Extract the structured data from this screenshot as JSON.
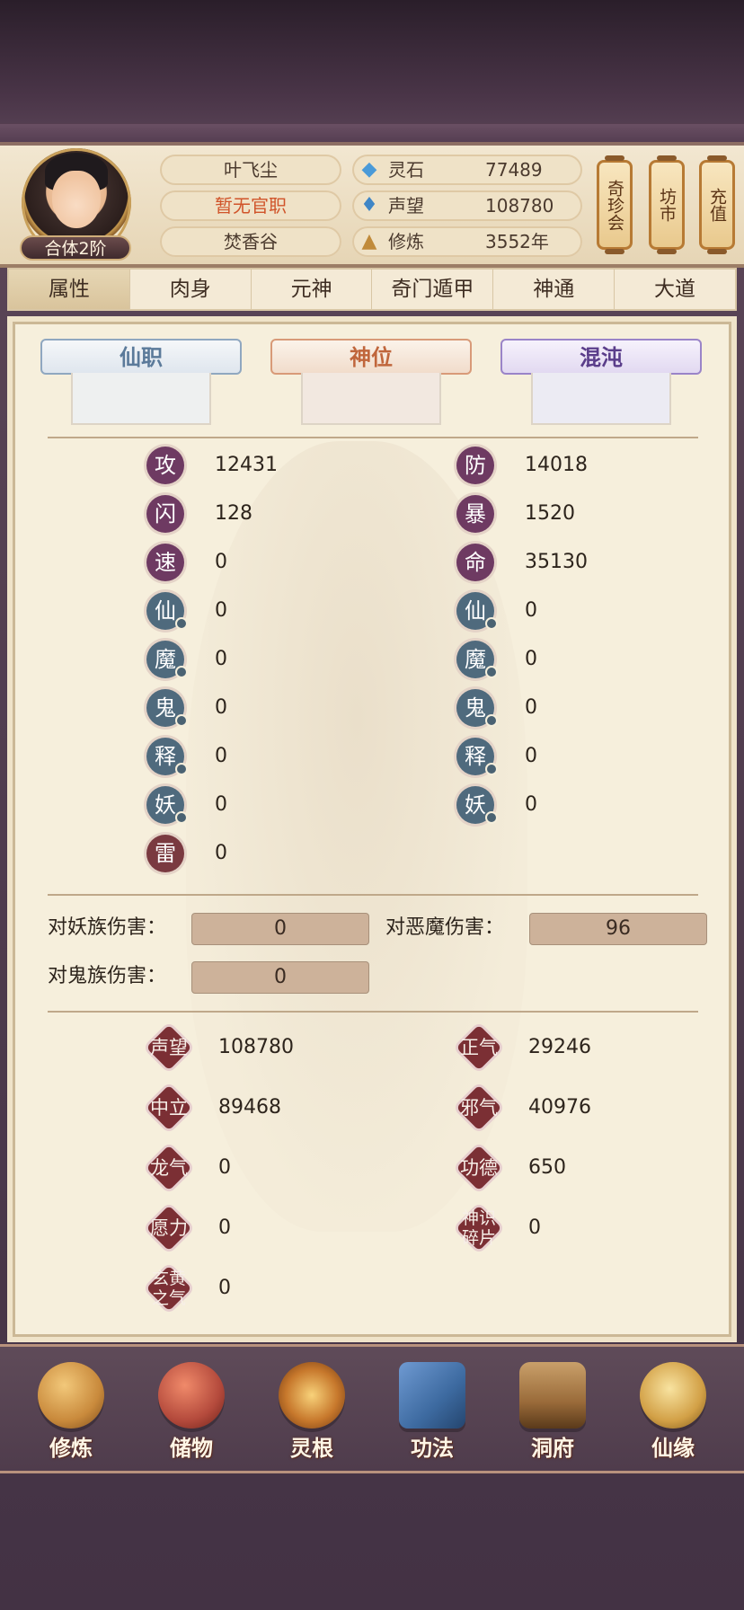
{
  "player": {
    "name": "叶飞尘",
    "title": "暂无官职",
    "sect": "焚香谷",
    "rank": "合体2阶"
  },
  "resources": [
    {
      "icon": "spirit-stone-icon",
      "label": "灵石",
      "value": "77489"
    },
    {
      "icon": "reputation-icon",
      "label": "声望",
      "value": "108780"
    },
    {
      "icon": "cultivation-icon",
      "label": "修炼",
      "value": "3552年"
    }
  ],
  "side_buttons": [
    "奇珍会",
    "坊市",
    "充值"
  ],
  "tabs": [
    "属性",
    "肉身",
    "元神",
    "奇门遁甲",
    "神通",
    "大道"
  ],
  "active_tab": "属性",
  "categories": [
    {
      "label": "仙职",
      "color": "#5b7a9a"
    },
    {
      "label": "神位",
      "color": "#c0663c"
    },
    {
      "label": "混沌",
      "color": "#5a3d8a"
    }
  ],
  "stats_left": [
    {
      "label": "攻",
      "value": "12431",
      "style": "purple"
    },
    {
      "label": "闪",
      "value": "128",
      "style": "purple"
    },
    {
      "label": "速",
      "value": "0",
      "style": "purple"
    },
    {
      "label": "仙",
      "value": "0",
      "style": "blue"
    },
    {
      "label": "魔",
      "value": "0",
      "style": "blue"
    },
    {
      "label": "鬼",
      "value": "0",
      "style": "blue"
    },
    {
      "label": "释",
      "value": "0",
      "style": "blue"
    },
    {
      "label": "妖",
      "value": "0",
      "style": "blue"
    },
    {
      "label": "雷",
      "value": "0",
      "style": "red"
    }
  ],
  "stats_right": [
    {
      "label": "防",
      "value": "14018",
      "style": "purple"
    },
    {
      "label": "暴",
      "value": "1520",
      "style": "purple"
    },
    {
      "label": "命",
      "value": "35130",
      "style": "purple"
    },
    {
      "label": "仙",
      "value": "0",
      "style": "blue"
    },
    {
      "label": "魔",
      "value": "0",
      "style": "blue"
    },
    {
      "label": "鬼",
      "value": "0",
      "style": "blue"
    },
    {
      "label": "释",
      "value": "0",
      "style": "blue"
    },
    {
      "label": "妖",
      "value": "0",
      "style": "blue"
    }
  ],
  "damage": [
    {
      "label": "对妖族伤害：",
      "value": "0"
    },
    {
      "label": "对恶魔伤害：",
      "value": "96"
    },
    {
      "label": "对鬼族伤害：",
      "value": "0"
    }
  ],
  "reputation": [
    {
      "label": "声望",
      "value": "108780"
    },
    {
      "label": "正气",
      "value": "29246"
    },
    {
      "label": "中立",
      "value": "89468"
    },
    {
      "label": "邪气",
      "value": "40976"
    },
    {
      "label": "龙气",
      "value": "0"
    },
    {
      "label": "功德",
      "value": "650"
    },
    {
      "label": "愿力",
      "value": "0"
    },
    {
      "label": "神识碎片",
      "value": "0"
    },
    {
      "label": "玄黄之气",
      "value": "0"
    }
  ],
  "bottom_nav": [
    {
      "label": "修炼",
      "icon": "meditation-icon",
      "color": "#c98a3c"
    },
    {
      "label": "储物",
      "icon": "bag-icon",
      "color": "#b44a3c"
    },
    {
      "label": "灵根",
      "icon": "spirit-root-icon",
      "color": "#c7782c"
    },
    {
      "label": "功法",
      "icon": "book-icon",
      "color": "#3d6aa0"
    },
    {
      "label": "洞府",
      "icon": "pavilion-icon",
      "color": "#9a6b3a"
    },
    {
      "label": "仙缘",
      "icon": "gourd-icon",
      "color": "#d2a046"
    }
  ]
}
